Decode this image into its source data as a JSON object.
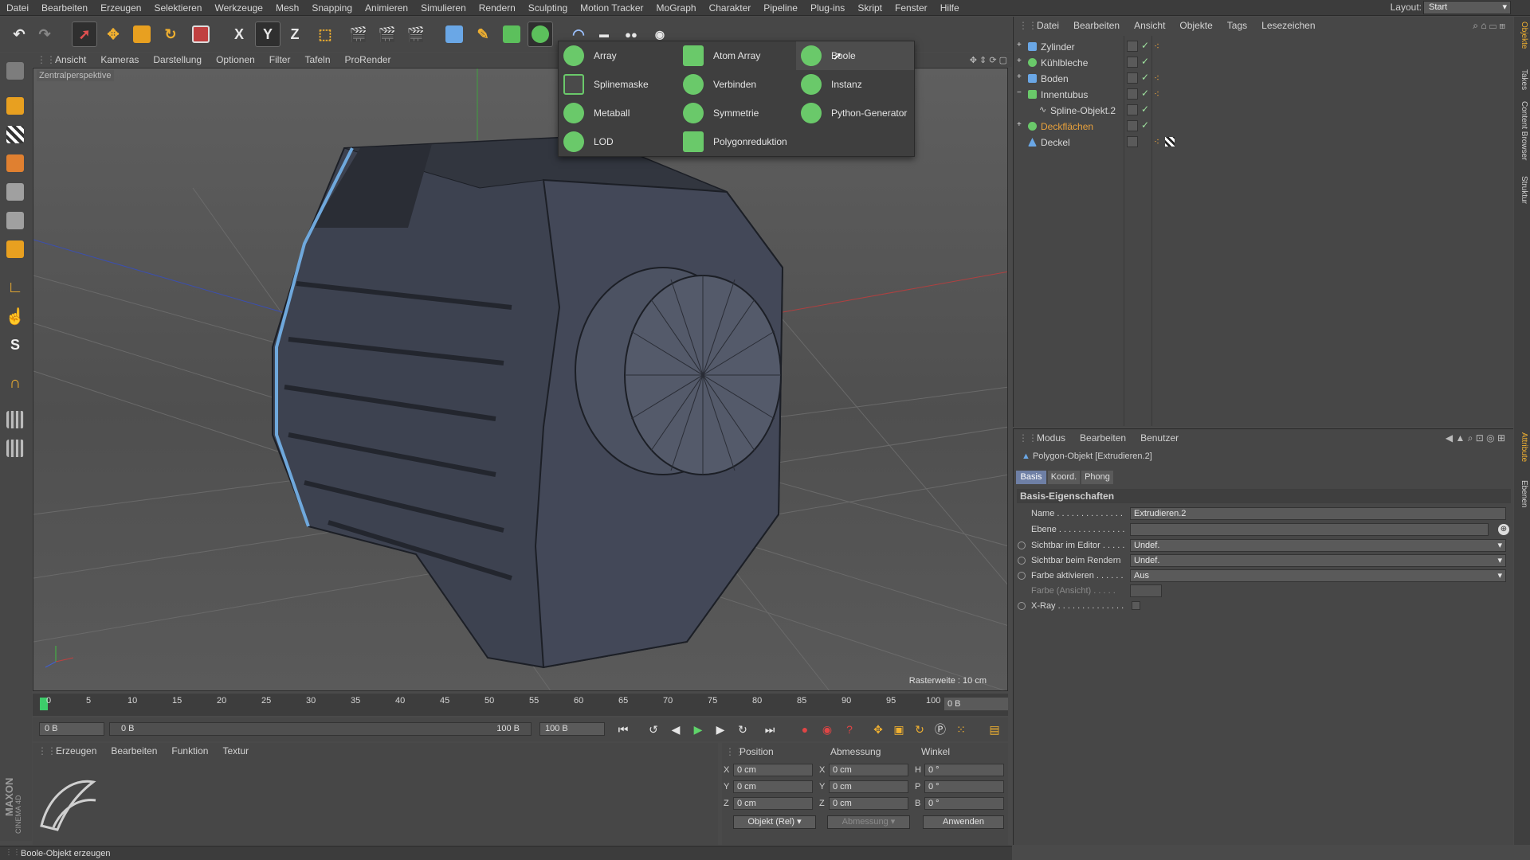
{
  "menubar": {
    "items": [
      "Datei",
      "Bearbeiten",
      "Erzeugen",
      "Selektieren",
      "Werkzeuge",
      "Mesh",
      "Snapping",
      "Animieren",
      "Simulieren",
      "Rendern",
      "Sculpting",
      "Motion Tracker",
      "MoGraph",
      "Charakter",
      "Pipeline",
      "Plug-ins",
      "Skript",
      "Fenster",
      "Hilfe"
    ],
    "layout_label": "Layout:",
    "layout_value": "Start"
  },
  "toolbar": {
    "axis_x": "X",
    "axis_y": "Y",
    "axis_z": "Z"
  },
  "viewport": {
    "menu": [
      "Ansicht",
      "Kameras",
      "Darstellung",
      "Optionen",
      "Filter",
      "Tafeln",
      "ProRender"
    ],
    "camera_label": "Zentralperspektive",
    "grid_label": "Rasterweite : 10 cm"
  },
  "generator_dropdown": {
    "columns": [
      [
        "Array",
        "Splinemaske",
        "Metaball",
        "LOD"
      ],
      [
        "Atom Array",
        "Verbinden",
        "Symmetrie",
        "Polygonreduktion"
      ],
      [
        "Boole",
        "Instanz",
        "Python-Generator"
      ]
    ],
    "highlighted": "Boole"
  },
  "timeline": {
    "ticks": [
      "0",
      "5",
      "10",
      "15",
      "20",
      "25",
      "30",
      "35",
      "40",
      "45",
      "50",
      "55",
      "60",
      "65",
      "70",
      "75",
      "80",
      "85",
      "90",
      "95",
      "100"
    ],
    "current_frame": "0 B",
    "start_field": "0 B",
    "range_start": "0 B",
    "range_end": "100 B",
    "end_field": "100 B"
  },
  "material_manager": {
    "menu": [
      "Erzeugen",
      "Bearbeiten",
      "Funktion",
      "Textur"
    ],
    "logo_line1": "MAXON",
    "logo_line2": "CINEMA 4D"
  },
  "coordinates": {
    "headers": [
      "Position",
      "Abmessung",
      "Winkel"
    ],
    "rows": [
      {
        "pos_label": "X",
        "pos_val": "0 cm",
        "size_label": "X",
        "size_val": "0 cm",
        "rot_label": "H",
        "rot_val": "0 °"
      },
      {
        "pos_label": "Y",
        "pos_val": "0 cm",
        "size_label": "Y",
        "size_val": "0 cm",
        "rot_label": "P",
        "rot_val": "0 °"
      },
      {
        "pos_label": "Z",
        "pos_val": "0 cm",
        "size_label": "Z",
        "size_val": "0 cm",
        "rot_label": "B",
        "rot_val": "0 °"
      }
    ],
    "mode_select": "Objekt (Rel)",
    "size_select": "Abmessung",
    "apply_button": "Anwenden"
  },
  "status_bar": "Boole-Objekt erzeugen",
  "object_manager": {
    "menu": [
      "Datei",
      "Bearbeiten",
      "Ansicht",
      "Objekte",
      "Tags",
      "Lesezeichen"
    ],
    "objects": [
      {
        "name": "Zylinder",
        "color": "#6aa7e6",
        "indent": 0,
        "expand": "+"
      },
      {
        "name": "Kühlbleche",
        "color": "#6ac96a",
        "indent": 0,
        "expand": "+"
      },
      {
        "name": "Boden",
        "color": "#6aa7e6",
        "indent": 0,
        "expand": "+"
      },
      {
        "name": "Innentubus",
        "color": "#6ac96a",
        "indent": 0,
        "expand": "−"
      },
      {
        "name": "Spline-Objekt.2",
        "color": "#c8c8c8",
        "indent": 1,
        "expand": ""
      },
      {
        "name": "Deckflächen",
        "color": "#6ac96a",
        "indent": 0,
        "expand": "+",
        "highlight": "#e8a13c"
      },
      {
        "name": "Deckel",
        "color": "#6aa7e6",
        "indent": 0,
        "expand": ""
      }
    ]
  },
  "attribute_manager": {
    "menu": [
      "Modus",
      "Bearbeiten",
      "Benutzer"
    ],
    "object_title": "Polygon-Objekt [Extrudieren.2]",
    "tabs": [
      "Basis",
      "Koord.",
      "Phong"
    ],
    "section": "Basis-Eigenschaften",
    "fields": [
      {
        "label": "Name . . . . . . . . . . . . . .",
        "value": "Extrudieren.2"
      },
      {
        "label": "Ebene . . . . . . . . . . . . . .",
        "value": ""
      },
      {
        "label": "Sichtbar im Editor . . . . .",
        "value": "Undef."
      },
      {
        "label": "Sichtbar beim Rendern",
        "value": "Undef."
      },
      {
        "label": "Farbe aktivieren . . . . . .",
        "value": "Aus"
      },
      {
        "label": "Farbe (Ansicht) . . . . .",
        "value": ""
      },
      {
        "label": "X-Ray . . . . . . . . . . . . . .",
        "value": ""
      }
    ]
  },
  "right_dock": {
    "tabs": [
      "Objekte",
      "Takes",
      "Content Browser",
      "Struktur",
      "Attribute",
      "Ebenen"
    ]
  }
}
